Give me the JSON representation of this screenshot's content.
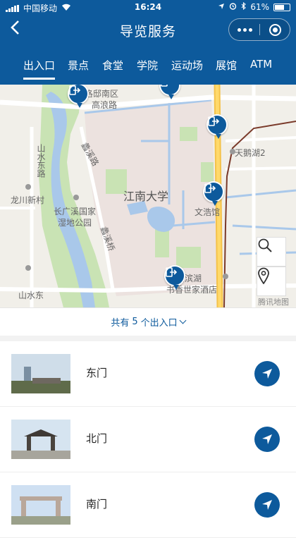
{
  "status_bar": {
    "carrier": "中国移动",
    "time": "16:24",
    "battery": "61%"
  },
  "title_bar": {
    "title": "导览服务"
  },
  "tabs": [
    {
      "label": "出入口",
      "active": true
    },
    {
      "label": "景点",
      "active": false
    },
    {
      "label": "食堂",
      "active": false
    },
    {
      "label": "学院",
      "active": false
    },
    {
      "label": "运动场",
      "active": false
    },
    {
      "label": "展馆",
      "active": false
    },
    {
      "label": "ATM",
      "active": false
    }
  ],
  "map": {
    "labels": {
      "luoqiao": "洛邸南区",
      "gaolang": "高浪路",
      "tianehu": "天鹅湖2",
      "shanshui_north": "山水东路",
      "longchuan": "龙川新村",
      "jiangnan": "江南大学",
      "wenhao": "文浩馆",
      "changguangxi": "长广溪国家",
      "shidi": "湿地公园",
      "lixi": "蠡溪桥",
      "binhu": "锡滨湖",
      "shuxiang": "书香世家酒店",
      "shanshui_south": "山水东",
      "tengxun": "腾讯地图",
      "jingxi": "蠡溪路"
    },
    "accent_color": "#0d5a9c"
  },
  "summary": {
    "prefix": "共有",
    "count": "5",
    "suffix": "个出入口"
  },
  "gates": [
    {
      "name": "东门"
    },
    {
      "name": "北门"
    },
    {
      "name": "南门"
    }
  ]
}
